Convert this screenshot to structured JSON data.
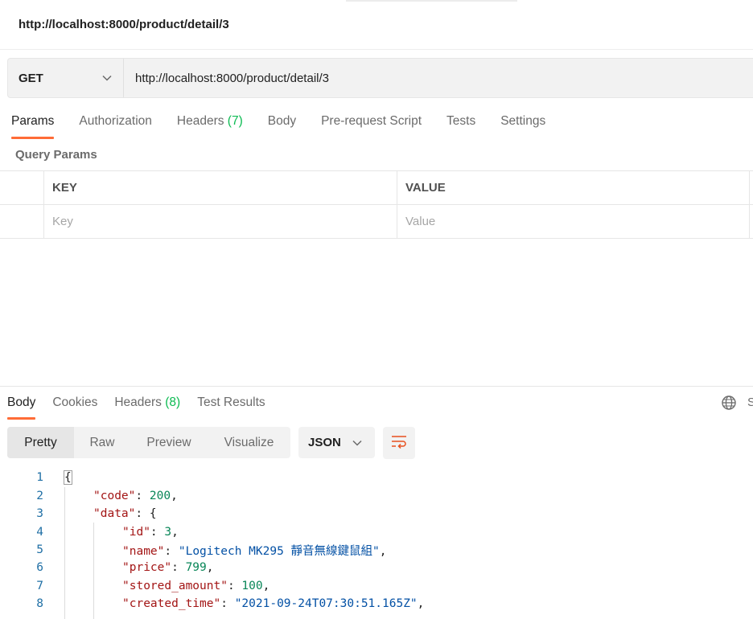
{
  "request": {
    "title": "http://localhost:8000/product/detail/3",
    "method": "GET",
    "url": "http://localhost:8000/product/detail/3"
  },
  "request_tabs": [
    {
      "label": "Params",
      "active": true
    },
    {
      "label": "Authorization"
    },
    {
      "label": "Headers",
      "count": "(7)"
    },
    {
      "label": "Body"
    },
    {
      "label": "Pre-request Script"
    },
    {
      "label": "Tests"
    },
    {
      "label": "Settings"
    }
  ],
  "query_params": {
    "label": "Query Params",
    "headers": {
      "key": "KEY",
      "value": "VALUE"
    },
    "placeholders": {
      "key": "Key",
      "value": "Value"
    }
  },
  "response_tabs": [
    {
      "label": "Body",
      "active": true
    },
    {
      "label": "Cookies"
    },
    {
      "label": "Headers",
      "count": "(8)"
    },
    {
      "label": "Test Results"
    }
  ],
  "response_right": {
    "truncated_label": "S",
    "icon": "globe-icon"
  },
  "view_modes": [
    {
      "label": "Pretty",
      "active": true
    },
    {
      "label": "Raw"
    },
    {
      "label": "Preview"
    },
    {
      "label": "Visualize"
    }
  ],
  "format": "JSON",
  "wrap_icon": "wrap-lines-icon",
  "colors": {
    "accent": "#ff6c37",
    "count_green": "#0cbb52",
    "json_key": "#a31515",
    "json_string": "#0451a5",
    "json_number": "#098658",
    "line_number": "#1f6fa5"
  },
  "response_body": {
    "line_numbers": [
      "1",
      "2",
      "3",
      "4",
      "5",
      "6",
      "7",
      "8"
    ],
    "lines": {
      "l1": {
        "open": "{"
      },
      "l2": {
        "key": "\"code\"",
        "sep": ": ",
        "value": "200",
        "end": ","
      },
      "l3": {
        "key": "\"data\"",
        "sep": ": ",
        "open": "{"
      },
      "l4": {
        "key": "\"id\"",
        "sep": ": ",
        "value": "3",
        "end": ","
      },
      "l5": {
        "key": "\"name\"",
        "sep": ": ",
        "value": "\"Logitech MK295 靜音無線鍵鼠組\"",
        "end": ","
      },
      "l6": {
        "key": "\"price\"",
        "sep": ": ",
        "value": "799",
        "end": ","
      },
      "l7": {
        "key": "\"stored_amount\"",
        "sep": ": ",
        "value": "100",
        "end": ","
      },
      "l8": {
        "key": "\"created_time\"",
        "sep": ": ",
        "value": "\"2021-09-24T07:30:51.165Z\"",
        "end": ","
      }
    }
  }
}
